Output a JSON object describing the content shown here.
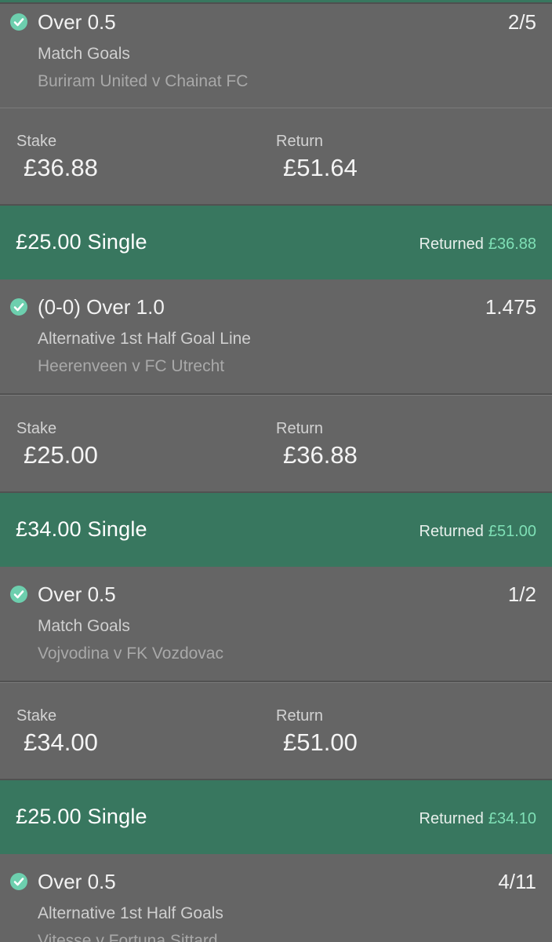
{
  "bets": [
    {
      "header": null,
      "selection": "Over 0.5",
      "odds": "2/5",
      "market": "Match Goals",
      "event": "Buriram United v Chainat FC",
      "stake_label": "Stake",
      "stake": "£36.88",
      "return_label": "Return",
      "return": "£51.64"
    },
    {
      "header": {
        "title": "£25.00 Single",
        "returned_label": "Returned",
        "returned_amount": "£36.88"
      },
      "selection": "(0-0) Over 1.0",
      "odds": "1.475",
      "market": "Alternative 1st Half Goal Line",
      "event": "Heerenveen v FC Utrecht",
      "stake_label": "Stake",
      "stake": "£25.00",
      "return_label": "Return",
      "return": "£36.88"
    },
    {
      "header": {
        "title": "£34.00 Single",
        "returned_label": "Returned",
        "returned_amount": "£51.00"
      },
      "selection": "Over 0.5",
      "odds": "1/2",
      "market": "Match Goals",
      "event": "Vojvodina v FK Vozdovac",
      "stake_label": "Stake",
      "stake": "£34.00",
      "return_label": "Return",
      "return": "£51.00"
    },
    {
      "header": {
        "title": "£25.00 Single",
        "returned_label": "Returned",
        "returned_amount": "£34.10"
      },
      "selection": "Over 0.5",
      "odds": "4/11",
      "market": "Alternative 1st Half Goals",
      "event": "Vitesse v Fortuna Sittard"
    }
  ],
  "colors": {
    "header_green": "#38775f",
    "check_green": "#6dcfae",
    "returned_amount_green": "#7fe0b6",
    "panel_gray": "#656565",
    "gap_gray": "#515151"
  },
  "icons": {
    "selection_status": "check-circle-icon"
  }
}
